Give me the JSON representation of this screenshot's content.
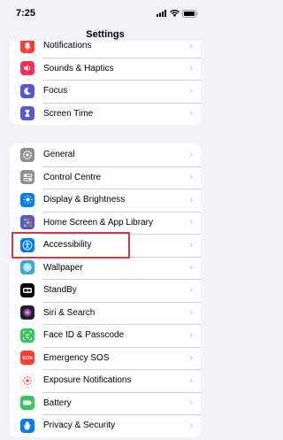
{
  "status_bar": {
    "time": "7:25"
  },
  "nav": {
    "title": "Settings"
  },
  "group1": [
    {
      "label": "Notifications",
      "icon": "bell-icon",
      "color": "#ff3b30"
    },
    {
      "label": "Sounds & Haptics",
      "icon": "speaker-icon",
      "color": "#ff2d55"
    },
    {
      "label": "Focus",
      "icon": "moon-icon",
      "color": "#5856d6"
    },
    {
      "label": "Screen Time",
      "icon": "hourglass-icon",
      "color": "#5856d6"
    }
  ],
  "group2": [
    {
      "label": "General",
      "icon": "gear-icon",
      "color": "#8e8e93"
    },
    {
      "label": "Control Centre",
      "icon": "switches-icon",
      "color": "#8e8e93"
    },
    {
      "label": "Display & Brightness",
      "icon": "sun-icon",
      "color": "#007aff"
    },
    {
      "label": "Home Screen & App Library",
      "icon": "grid-icon",
      "color": "#5856d6"
    },
    {
      "label": "Accessibility",
      "icon": "accessibility-icon",
      "color": "#007aff"
    },
    {
      "label": "Wallpaper",
      "icon": "flower-icon",
      "color": "#34aadc"
    },
    {
      "label": "StandBy",
      "icon": "standby-icon",
      "color": "#000000"
    },
    {
      "label": "Siri & Search",
      "icon": "siri-icon",
      "color": "#222222"
    },
    {
      "label": "Face ID & Passcode",
      "icon": "faceid-icon",
      "color": "#34c759"
    },
    {
      "label": "Emergency SOS",
      "icon": "sos-icon",
      "color": "#ff3b30"
    },
    {
      "label": "Exposure Notifications",
      "icon": "exposure-icon",
      "color": "#ffffff"
    },
    {
      "label": "Battery",
      "icon": "battery-icon",
      "color": "#34c759"
    },
    {
      "label": "Privacy & Security",
      "icon": "hand-icon",
      "color": "#007aff"
    }
  ],
  "highlight_label": "Accessibility"
}
